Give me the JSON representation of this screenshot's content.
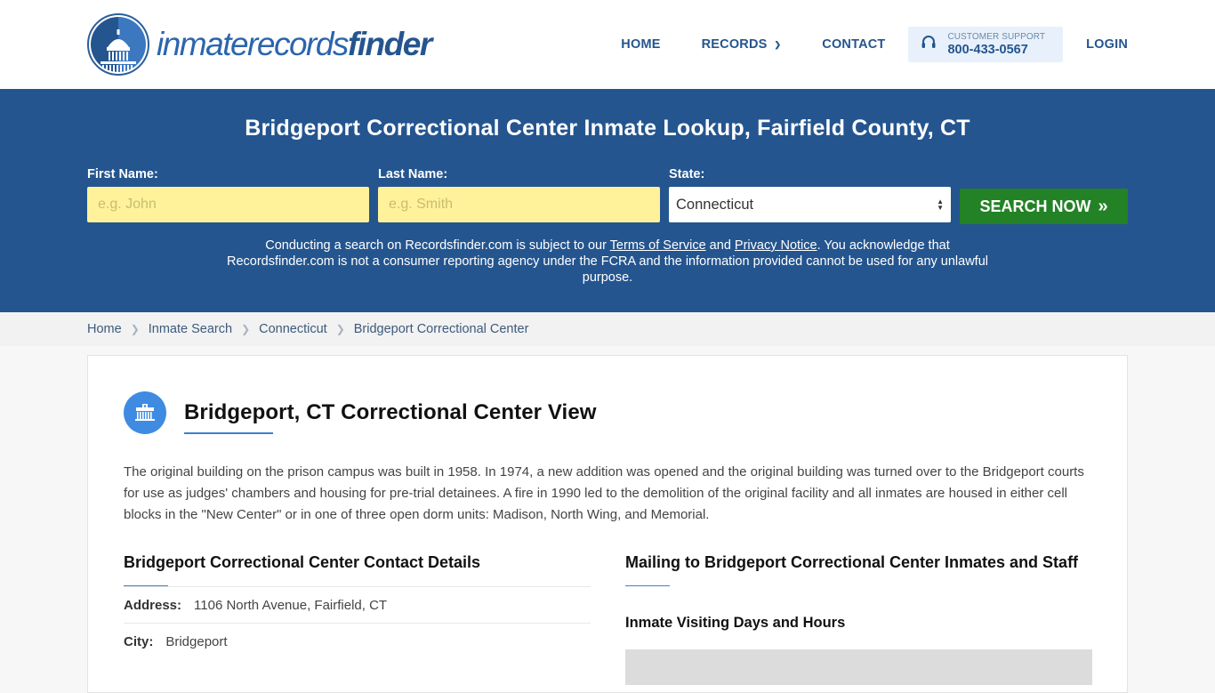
{
  "header": {
    "logo": {
      "light": "inmaterecords",
      "bold": "finder"
    },
    "nav": {
      "home": "HOME",
      "records": "RECORDS",
      "contact": "CONTACT",
      "support_label": "CUSTOMER SUPPORT",
      "support_phone": "800-433-0567",
      "login": "LOGIN"
    }
  },
  "hero": {
    "title": "Bridgeport Correctional Center Inmate Lookup, Fairfield County, CT",
    "form": {
      "first_name_label": "First Name:",
      "first_name_placeholder": "e.g. John",
      "first_name_value": "",
      "last_name_label": "Last Name:",
      "last_name_placeholder": "e.g. Smith",
      "last_name_value": "",
      "state_label": "State:",
      "state_value": "Connecticut",
      "search_button": "SEARCH NOW"
    },
    "disclaimer": {
      "part1": "Conducting a search on Recordsfinder.com is subject to our ",
      "terms_link": "Terms of Service",
      "part2": " and ",
      "privacy_link": "Privacy Notice",
      "part3": ". You acknowledge that Recordsfinder.com is not a consumer reporting agency under the FCRA and the information provided cannot be used for any unlawful purpose."
    }
  },
  "breadcrumb": [
    {
      "label": "Home"
    },
    {
      "label": "Inmate Search"
    },
    {
      "label": "Connecticut"
    },
    {
      "label": "Bridgeport Correctional Center"
    }
  ],
  "main": {
    "title": "Bridgeport, CT Correctional Center View",
    "intro": "The original building on the prison campus was built in 1958. In 1974, a new addition was opened and the original building was turned over to the Bridgeport courts for use as judges' chambers and housing for pre-trial detainees. A fire in 1990 led to the demolition of the original facility and all inmates are housed in either cell blocks in the \"New Center\" or in one of three open dorm units: Madison, North Wing, and Memorial.",
    "contact": {
      "title": "Bridgeport Correctional Center Contact Details",
      "rows": [
        {
          "label": "Address:",
          "value": "1106 North Avenue, Fairfield, CT"
        },
        {
          "label": "City:",
          "value": "Bridgeport"
        }
      ]
    },
    "mailing": {
      "title": "Mailing to Bridgeport Correctional Center Inmates and Staff",
      "visiting_title": "Inmate Visiting Days and Hours"
    }
  },
  "colors": {
    "brand_blue": "#24558f",
    "search_green": "#238225",
    "input_yellow": "#fff29a",
    "accent_blue": "#3f8be2"
  }
}
